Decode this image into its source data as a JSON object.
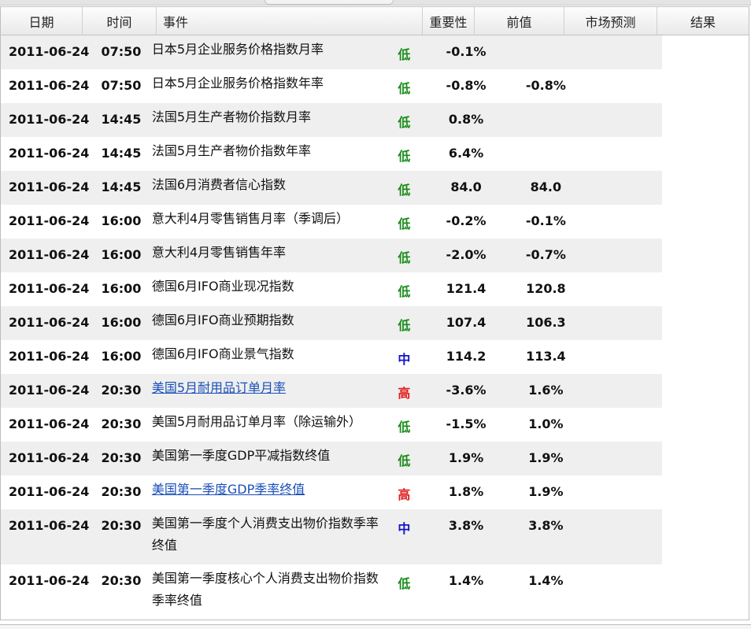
{
  "header": {
    "date": "日期",
    "time": "时间",
    "event": "事件",
    "importance": "重要性",
    "previous": "前值",
    "forecast": "市场预测",
    "result": "结果"
  },
  "colors": {
    "low": "#1c8d1c",
    "medium": "#1414c8",
    "high": "#e01b1b",
    "link": "#1a4fb8",
    "row_shade": "#efefef"
  },
  "rows": [
    {
      "date": "2011-06-24",
      "time": "07:50",
      "event": "日本5月企业服务价格指数月率",
      "importance": "低",
      "level": "low",
      "previous": "-0.1%",
      "forecast": "",
      "result": "",
      "link": false
    },
    {
      "date": "2011-06-24",
      "time": "07:50",
      "event": "日本5月企业服务价格指数年率",
      "importance": "低",
      "level": "low",
      "previous": "-0.8%",
      "forecast": "-0.8%",
      "result": "",
      "link": false
    },
    {
      "date": "2011-06-24",
      "time": "14:45",
      "event": "法国5月生产者物价指数月率",
      "importance": "低",
      "level": "low",
      "previous": "0.8%",
      "forecast": "",
      "result": "",
      "link": false
    },
    {
      "date": "2011-06-24",
      "time": "14:45",
      "event": "法国5月生产者物价指数年率",
      "importance": "低",
      "level": "low",
      "previous": "6.4%",
      "forecast": "",
      "result": "",
      "link": false
    },
    {
      "date": "2011-06-24",
      "time": "14:45",
      "event": "法国6月消费者信心指数",
      "importance": "低",
      "level": "low",
      "previous": "84.0",
      "forecast": "84.0",
      "result": "",
      "link": false
    },
    {
      "date": "2011-06-24",
      "time": "16:00",
      "event": "意大利4月零售销售月率（季调后）",
      "importance": "低",
      "level": "low",
      "previous": "-0.2%",
      "forecast": "-0.1%",
      "result": "",
      "link": false
    },
    {
      "date": "2011-06-24",
      "time": "16:00",
      "event": "意大利4月零售销售年率",
      "importance": "低",
      "level": "low",
      "previous": "-2.0%",
      "forecast": "-0.7%",
      "result": "",
      "link": false
    },
    {
      "date": "2011-06-24",
      "time": "16:00",
      "event": "德国6月IFO商业现况指数",
      "importance": "低",
      "level": "low",
      "previous": "121.4",
      "forecast": "120.8",
      "result": "",
      "link": false
    },
    {
      "date": "2011-06-24",
      "time": "16:00",
      "event": "德国6月IFO商业预期指数",
      "importance": "低",
      "level": "low",
      "previous": "107.4",
      "forecast": "106.3",
      "result": "",
      "link": false
    },
    {
      "date": "2011-06-24",
      "time": "16:00",
      "event": "德国6月IFO商业景气指数",
      "importance": "中",
      "level": "medium",
      "previous": "114.2",
      "forecast": "113.4",
      "result": "",
      "link": false
    },
    {
      "date": "2011-06-24",
      "time": "20:30",
      "event": "美国5月耐用品订单月率",
      "importance": "高",
      "level": "high",
      "previous": "-3.6%",
      "forecast": "1.6%",
      "result": "",
      "link": true
    },
    {
      "date": "2011-06-24",
      "time": "20:30",
      "event": "美国5月耐用品订单月率（除运输外）",
      "importance": "低",
      "level": "low",
      "previous": "-1.5%",
      "forecast": "1.0%",
      "result": "",
      "link": false
    },
    {
      "date": "2011-06-24",
      "time": "20:30",
      "event": "美国第一季度GDP平减指数终值",
      "importance": "低",
      "level": "low",
      "previous": "1.9%",
      "forecast": "1.9%",
      "result": "",
      "link": false
    },
    {
      "date": "2011-06-24",
      "time": "20:30",
      "event": "美国第一季度GDP季率终值",
      "importance": "高",
      "level": "high",
      "previous": "1.8%",
      "forecast": "1.9%",
      "result": "",
      "link": true
    },
    {
      "date": "2011-06-24",
      "time": "20:30",
      "event": "美国第一季度个人消费支出物价指数季率终值",
      "importance": "中",
      "level": "medium",
      "previous": "3.8%",
      "forecast": "3.8%",
      "result": "",
      "link": false
    },
    {
      "date": "2011-06-24",
      "time": "20:30",
      "event": "美国第一季度核心个人消费支出物价指数季率终值",
      "importance": "低",
      "level": "low",
      "previous": "1.4%",
      "forecast": "1.4%",
      "result": "",
      "link": false
    }
  ]
}
